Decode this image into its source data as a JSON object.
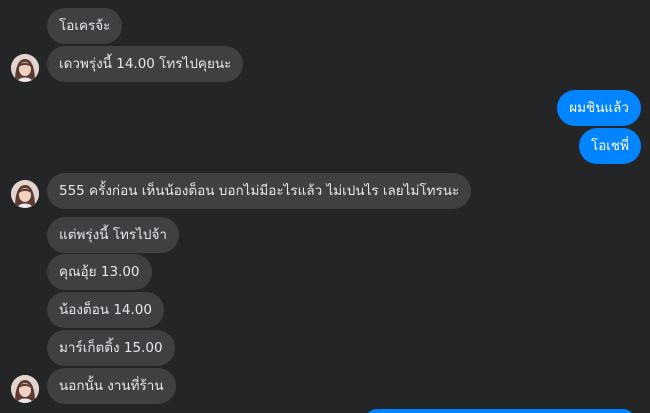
{
  "messages": [
    {
      "id": "m1",
      "text": "โอเครจ้ะ"
    },
    {
      "id": "m2",
      "text": "เดวพรุ่งนี้ 14.00 โทรไปคุยนะ"
    },
    {
      "id": "m3",
      "text": "ผมชินแล้ว"
    },
    {
      "id": "m4",
      "text": "โอเชพี่"
    },
    {
      "id": "m5",
      "text": "555 ครั้งก่อน เห็นน้องต็อน บอกไม่มีอะไรแล้ว ไม่เปนไร เลยไม่โทรนะ"
    },
    {
      "id": "m6",
      "text": "แต่พรุ่งนี้ โทรไปจ้า"
    },
    {
      "id": "m7",
      "text": "คุณอุ้ย 13.00"
    },
    {
      "id": "m8",
      "text": "น้องต็อน 14.00"
    },
    {
      "id": "m9",
      "text": "มาร์เก็ตติ้ง 15.00"
    },
    {
      "id": "m10",
      "text": "นอกนั้น งานที่ร้าน"
    }
  ],
  "colors": {
    "background": "#242526",
    "incoming_bubble": "#3e4042",
    "outgoing_bubble": "#0084ff",
    "incoming_text": "#e4e6eb",
    "outgoing_text": "#ffffff"
  },
  "icons": {
    "avatar": "contact-avatar"
  }
}
